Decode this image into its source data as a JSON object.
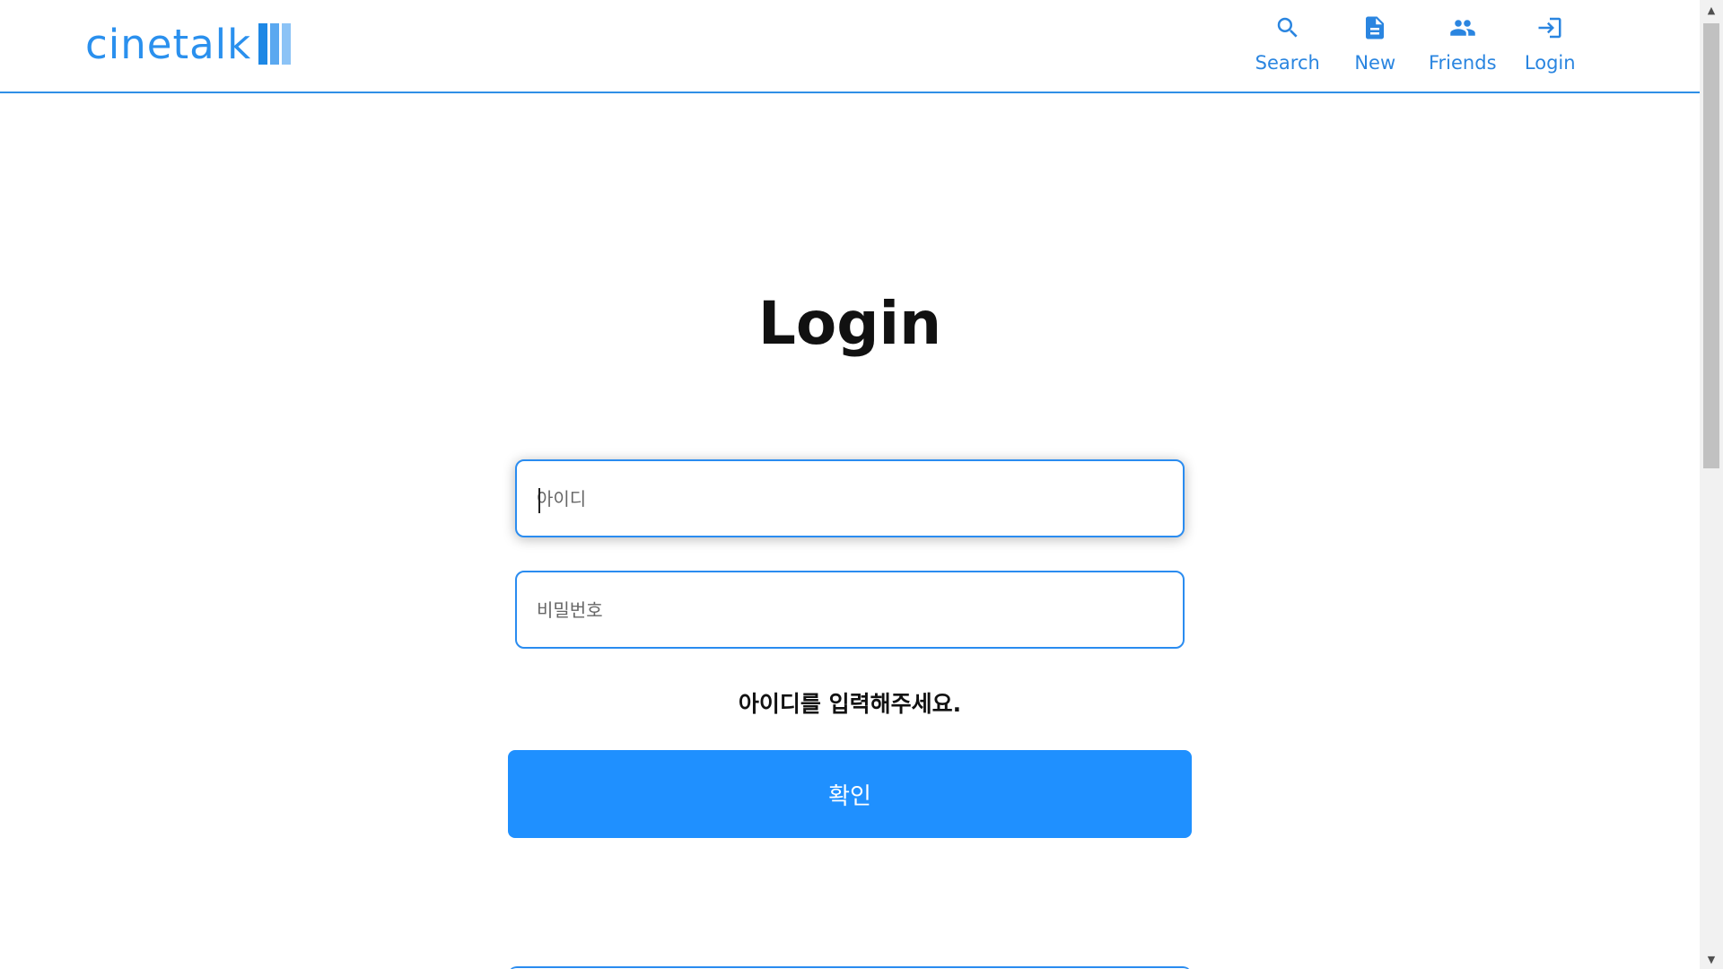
{
  "header": {
    "logo_text": "cinetalk",
    "nav": [
      {
        "label": "Search",
        "icon": "search-icon"
      },
      {
        "label": "New",
        "icon": "document-icon"
      },
      {
        "label": "Friends",
        "icon": "people-icon"
      },
      {
        "label": "Login",
        "icon": "login-icon"
      }
    ]
  },
  "main": {
    "title": "Login",
    "id_field": {
      "placeholder": "아이디",
      "value": ""
    },
    "password_field": {
      "placeholder": "비밀번호",
      "value": ""
    },
    "error_message": "아이디를 입력해주세요.",
    "confirm_label": "확인"
  },
  "colors": {
    "accent": "#1f90ff",
    "nav_text": "#2a85e0",
    "border": "#2a8cf0"
  }
}
